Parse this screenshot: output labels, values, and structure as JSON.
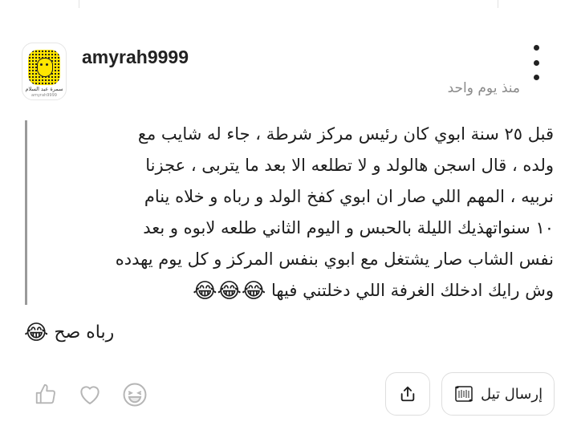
{
  "post": {
    "username": "amyrah9999",
    "timestamp": "منذ يوم واحد",
    "avatar": {
      "caption": "سمرة عبد السلام",
      "caption_small": "amyrah9999"
    },
    "quote_lines": [
      "قبل ٢٥ سنة ابوي كان رئيس مركز شرطة ، جاء له شايب مع",
      "ولده ، قال اسجن هالولد و لا تطلعه الا بعد ما يتربى ، عجزنا",
      "نربيه ، المهم اللي صار ان ابوي كفخ الولد و رباه و خلاه ينام",
      "١٠ سنواتهذيك الليلة بالحبس و اليوم الثاني طلعه لابوه و بعد",
      "نفس الشاب صار يشتغل مع ابوي بنفس المركز و كل يوم يهدده",
      "وش رايك ادخلك الغرفة اللي دخلتني فيها"
    ],
    "quote_last_line_emojis": "😂😂😂",
    "reply_text": "رباه صح",
    "reply_emoji": "😂"
  },
  "actions": {
    "send_label": "إرسال تيل"
  },
  "icons": {
    "like": "thumbs-up-icon",
    "heart": "heart-icon",
    "laugh": "laughing-face-icon",
    "share": "share-icon",
    "send": "scroll-icon",
    "more": "more-vertical-icon"
  }
}
